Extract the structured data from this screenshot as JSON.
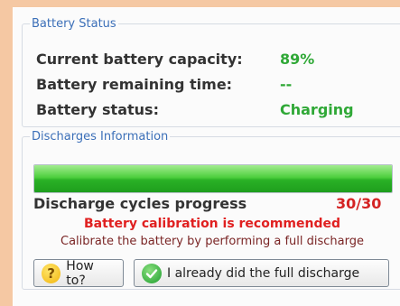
{
  "battery_status": {
    "legend": "Battery Status",
    "rows": [
      {
        "label": "Current battery capacity:",
        "value": "89%"
      },
      {
        "label": "Battery remaining time:",
        "value": "--"
      },
      {
        "label": "Battery status:",
        "value": "Charging"
      }
    ]
  },
  "discharges": {
    "legend": "Discharges Information",
    "progress_fraction": 1.0,
    "progress_label": "Discharge cycles progress",
    "progress_value": "30/30",
    "warning": "Battery calibration is recommended",
    "hint": "Calibrate the battery by performing a full discharge",
    "buttons": {
      "how_to": "How to?",
      "already_done": "I already did the full discharge"
    }
  },
  "colors": {
    "value_green": "#2fa836",
    "warning_red": "#e02020",
    "legend_blue": "#3b6fb8"
  }
}
